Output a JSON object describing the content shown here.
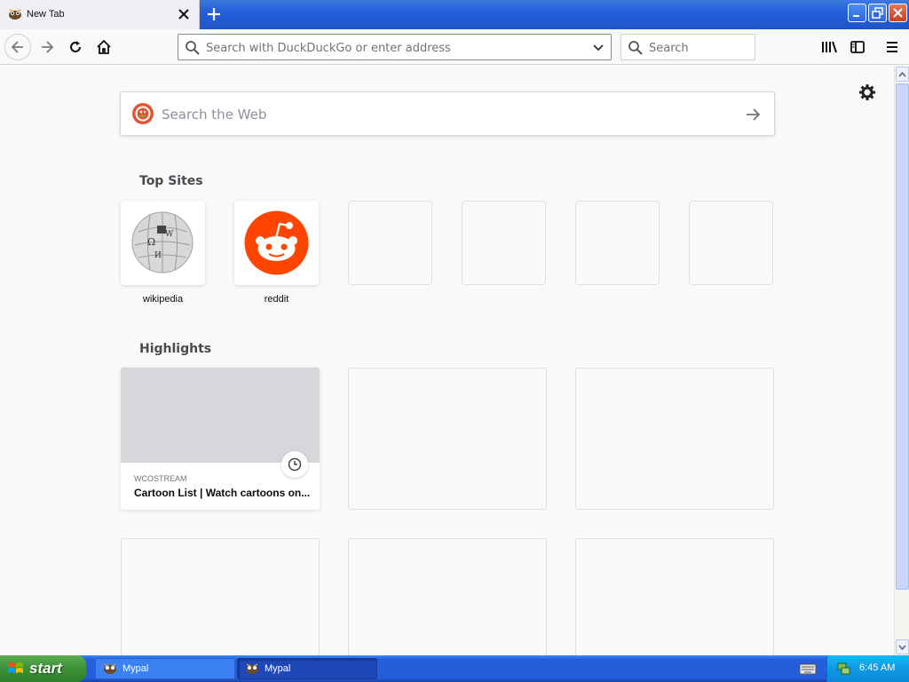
{
  "browser": {
    "tab": {
      "title": "New Tab"
    },
    "urlbar": {
      "placeholder": "Search with DuckDuckGo or enter address"
    },
    "searchbar": {
      "placeholder": "Search"
    }
  },
  "newtab": {
    "web_search": {
      "placeholder": "Search the Web"
    },
    "top_sites_title": "Top Sites",
    "top_sites": [
      {
        "label": "wikipedia",
        "icon": "wikipedia-globe-icon"
      },
      {
        "label": "reddit",
        "icon": "reddit-alien-icon"
      }
    ],
    "highlights_title": "Highlights",
    "highlights": [
      {
        "source": "WCOSTREAM",
        "title": "Cartoon List | Watch cartoons on..."
      }
    ]
  },
  "taskbar": {
    "start_label": "start",
    "tasks": [
      {
        "label": "Mypal"
      },
      {
        "label": "Mypal"
      }
    ],
    "clock": "6:45 AM"
  },
  "colors": {
    "reddit": "#ff4500",
    "accent": "#245edb"
  }
}
